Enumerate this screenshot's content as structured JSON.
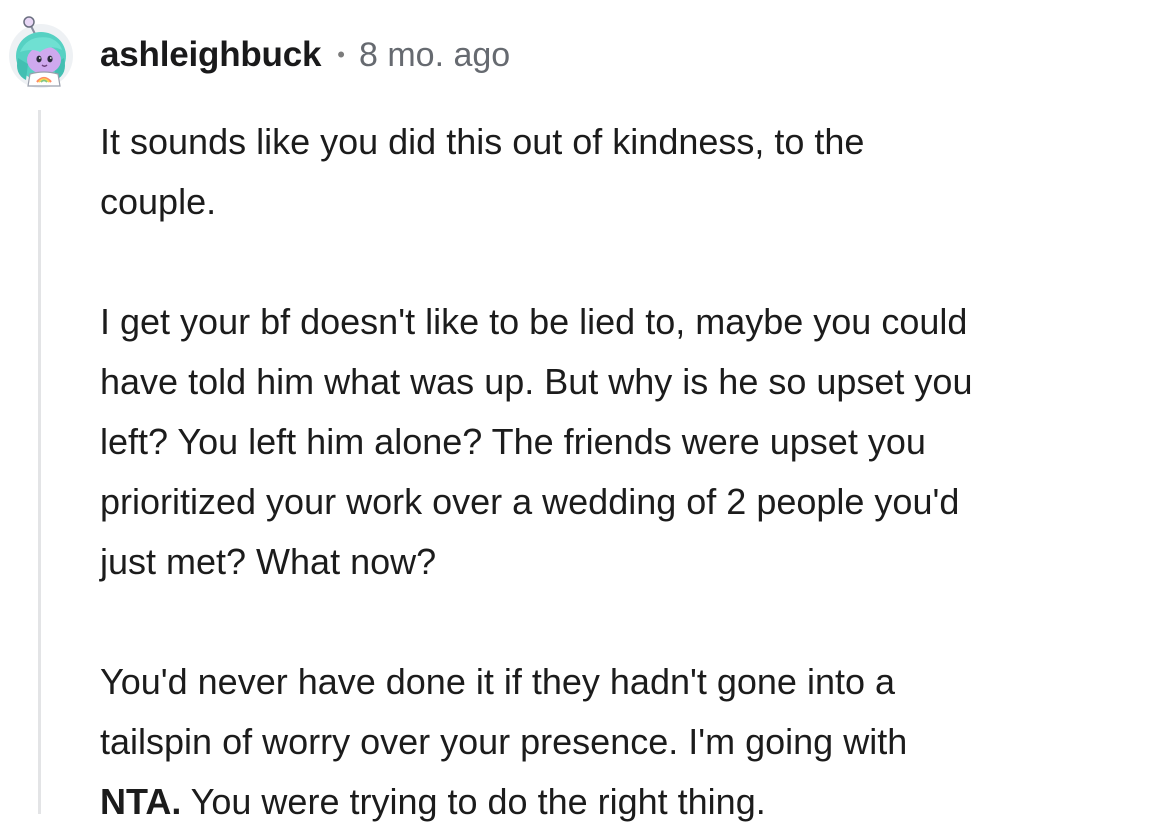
{
  "comment": {
    "username": "ashleighbuck",
    "separator": "•",
    "timestamp": "8 mo. ago",
    "avatar_icon": "snoo-avatar-icon",
    "paragraphs": [
      {
        "lines": [
          "It sounds like you did this out of kindness, to the",
          "couple."
        ]
      },
      {
        "lines": [
          "I get your bf doesn't like to be lied to, maybe you could",
          "have told him what was up. But why is he so upset you",
          "left? You left him alone? The friends were upset you",
          "prioritized your work over a wedding of 2 people you'd",
          "just met? What now?"
        ]
      },
      {
        "lines": [
          "You'd never have done it if they hadn't gone into a",
          "tailspin of worry over your presence. I'm going with"
        ],
        "verdict": "NTA.",
        "verdict_rest": " You were trying to do the right thing."
      }
    ]
  },
  "colors": {
    "text": "#1c1c1c",
    "meta": "#666a70",
    "thread_line": "#e3e4e6",
    "avatar_hair": "#5fd6c8",
    "avatar_face": "#c9a3e8"
  }
}
